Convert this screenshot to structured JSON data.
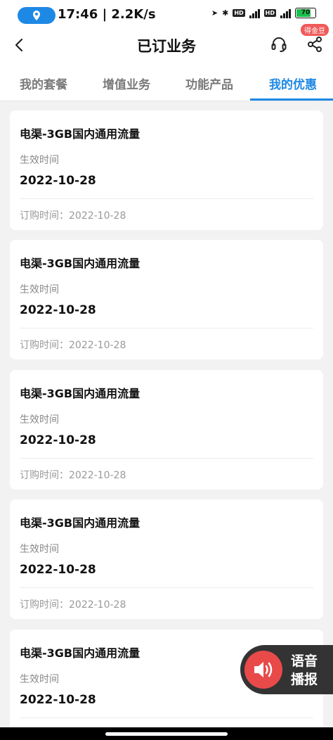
{
  "status_bar": {
    "time_and_speed": "17:46 | 2.2K/s",
    "battery_level": "70",
    "network_labels": [
      "HD",
      "5G",
      "HD",
      "5G"
    ]
  },
  "header": {
    "title": "已订业务",
    "badge": "得金豆"
  },
  "tabs": [
    {
      "label": "我的套餐",
      "active": false
    },
    {
      "label": "增值业务",
      "active": false
    },
    {
      "label": "功能产品",
      "active": false
    },
    {
      "label": "我的优惠",
      "active": true
    }
  ],
  "cards": [
    {
      "name": "电渠-3GB国内通用流量",
      "effective_label": "生效时间",
      "effective_date": "2022-10-28",
      "order_time": "订购时间：2022-10-28"
    },
    {
      "name": "电渠-3GB国内通用流量",
      "effective_label": "生效时间",
      "effective_date": "2022-10-28",
      "order_time": "订购时间：2022-10-28"
    },
    {
      "name": "电渠-3GB国内通用流量",
      "effective_label": "生效时间",
      "effective_date": "2022-10-28",
      "order_time": "订购时间：2022-10-28"
    },
    {
      "name": "电渠-3GB国内通用流量",
      "effective_label": "生效时间",
      "effective_date": "2022-10-28",
      "order_time": "订购时间：2022-10-28"
    },
    {
      "name": "电渠-3GB国内通用流量",
      "effective_label": "生效时间",
      "effective_date": "2022-10-28",
      "order_time": ""
    }
  ],
  "voice_button": {
    "label_line1": "语音",
    "label_line2": "播报"
  },
  "colors": {
    "accent": "#1e88e5",
    "badge": "#f05a5a",
    "voice_bg": "#333333",
    "voice_circle": "#e84a4a"
  }
}
